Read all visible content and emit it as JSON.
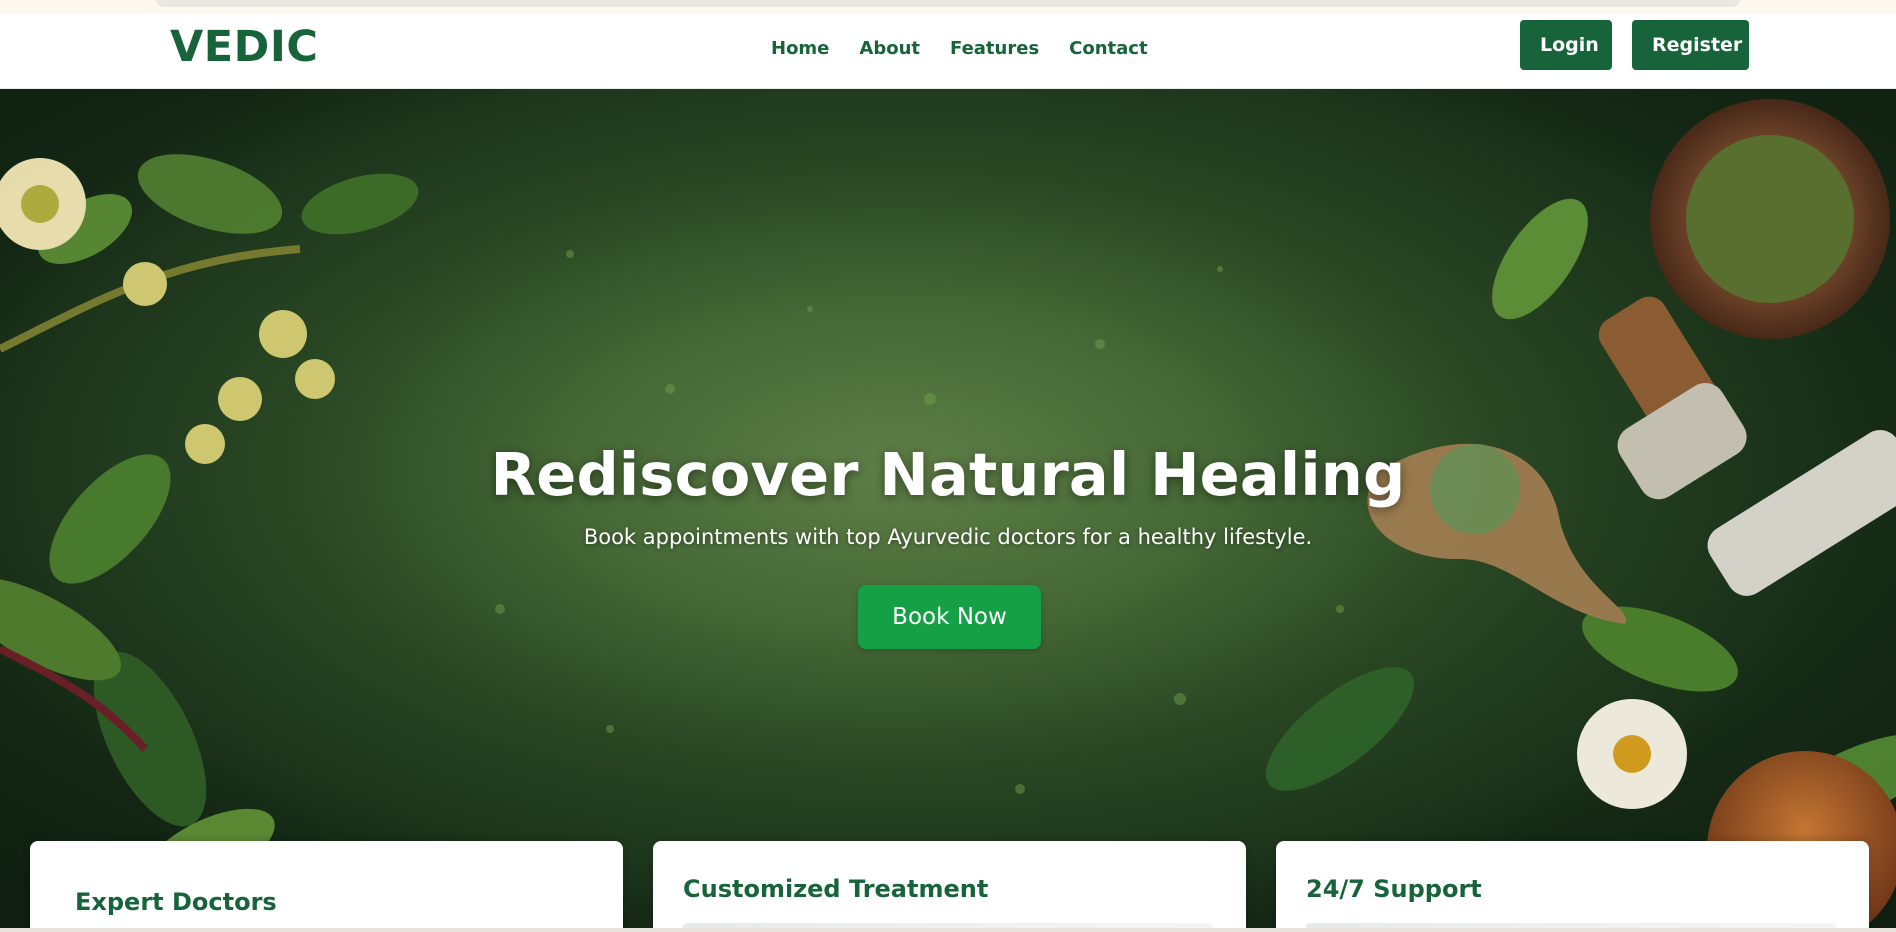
{
  "brand": "VEDIC",
  "nav": {
    "items": [
      "Home",
      "About",
      "Features",
      "Contact"
    ]
  },
  "auth": {
    "login": "Login",
    "register": "Register"
  },
  "hero": {
    "title": "Rediscover Natural Healing",
    "subtitle": "Book appointments with top Ayurvedic doctors for a healthy lifestyle.",
    "cta": "Book Now"
  },
  "features": [
    {
      "title": "Expert Doctors"
    },
    {
      "title": "Customized Treatment"
    },
    {
      "title": "24/7 Support"
    }
  ],
  "colors": {
    "brand_green": "#17633a",
    "button_green": "#15a046",
    "hero_dark": "#183019",
    "hero_mid": "#466a36",
    "white": "#ffffff"
  }
}
